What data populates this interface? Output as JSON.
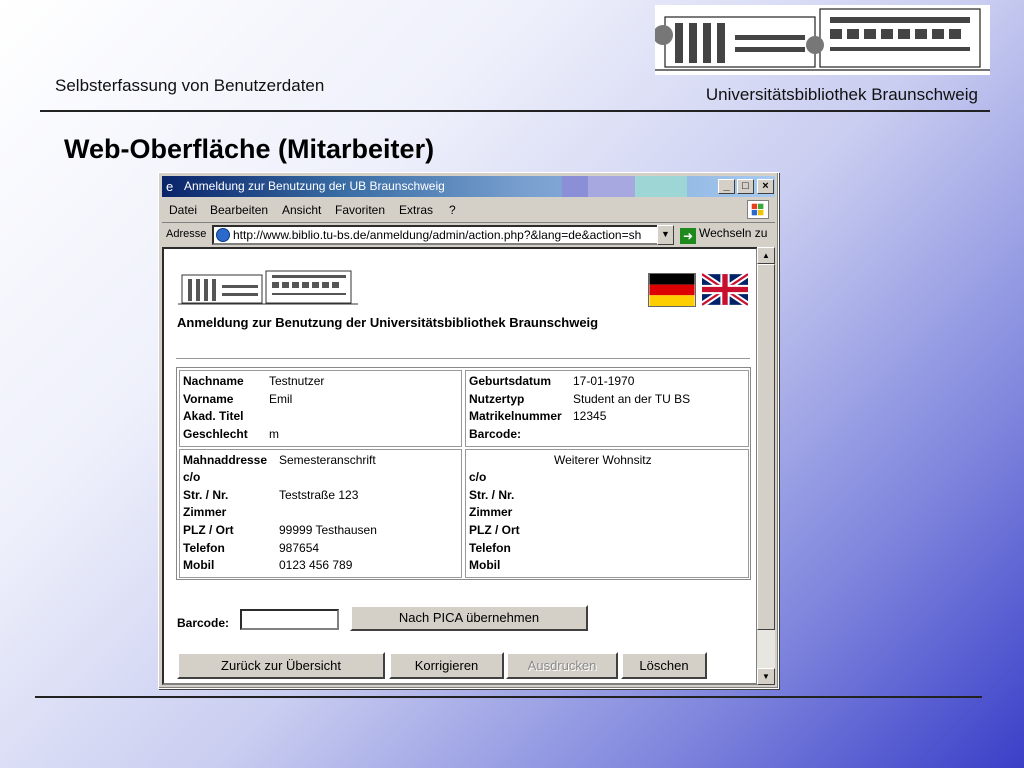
{
  "slide": {
    "subtitle": "Selbsterfassung von Benutzerdaten",
    "institution": "Universitätsbibliothek Braunschweig",
    "title": "Web-Oberfläche (Mitarbeiter)"
  },
  "window": {
    "title": "Anmeldung zur Benutzung der UB Braunschweig",
    "controls": {
      "minimize": "_",
      "maximize": "□",
      "close": "×"
    },
    "menu": [
      "Datei",
      "Bearbeiten",
      "Ansicht",
      "Favoriten",
      "Extras",
      "?"
    ],
    "address_label": "Adresse",
    "address": "http://www.biblio.tu-bs.de/anmeldung/admin/action.php?&lang=de&action=sh",
    "go_label": "Wechseln zu"
  },
  "page": {
    "heading": "Anmeldung zur Benutzung der Universitätsbibliothek Braunschweig",
    "personal_left": [
      {
        "label": "Nachname",
        "value": "Testnutzer"
      },
      {
        "label": "Vorname",
        "value": "Emil"
      },
      {
        "label": "Akad. Titel",
        "value": ""
      },
      {
        "label": "Geschlecht",
        "value": "m"
      }
    ],
    "personal_right": [
      {
        "label": "Geburtsdatum",
        "value": "17-01-1970"
      },
      {
        "label": "Nutzertyp",
        "value": "Student an der TU BS"
      },
      {
        "label": "Matrikelnummer",
        "value": "12345"
      },
      {
        "label": "Barcode:",
        "value": ""
      }
    ],
    "address_left": {
      "header_label": "Mahnaddresse",
      "header_value": "Semesteranschrift",
      "rows": [
        {
          "label": "c/o",
          "value": ""
        },
        {
          "label": "Str. / Nr.",
          "value": "Teststraße 123"
        },
        {
          "label": "Zimmer",
          "value": ""
        },
        {
          "label": "PLZ / Ort",
          "value": "99999 Testhausen"
        },
        {
          "label": "Telefon",
          "value": "987654"
        },
        {
          "label": "Mobil",
          "value": "0123 456 789"
        }
      ]
    },
    "address_right": {
      "header": "Weiterer Wohnsitz",
      "rows": [
        {
          "label": "c/o",
          "value": ""
        },
        {
          "label": "Str. / Nr.",
          "value": ""
        },
        {
          "label": "Zimmer",
          "value": ""
        },
        {
          "label": "PLZ / Ort",
          "value": ""
        },
        {
          "label": "Telefon",
          "value": ""
        },
        {
          "label": "Mobil",
          "value": ""
        }
      ]
    },
    "barcode_label": "Barcode:",
    "barcode_value": "",
    "pica_button": "Nach PICA übernehmen",
    "buttons": {
      "back": "Zurück zur Übersicht",
      "correct": "Korrigieren",
      "print": "Ausdrucken",
      "delete": "Löschen"
    }
  },
  "icons": [
    "ie-icon",
    "windows-flag-icon",
    "page-icon",
    "go-arrow-icon",
    "german-flag-icon",
    "uk-flag-icon",
    "scroll-up-icon",
    "scroll-down-icon"
  ],
  "colors": {
    "titlebar": "#0a246a",
    "window_face": "#d4d0c8",
    "flag_de": [
      "#000000",
      "#dd0000",
      "#ffce00"
    ]
  }
}
